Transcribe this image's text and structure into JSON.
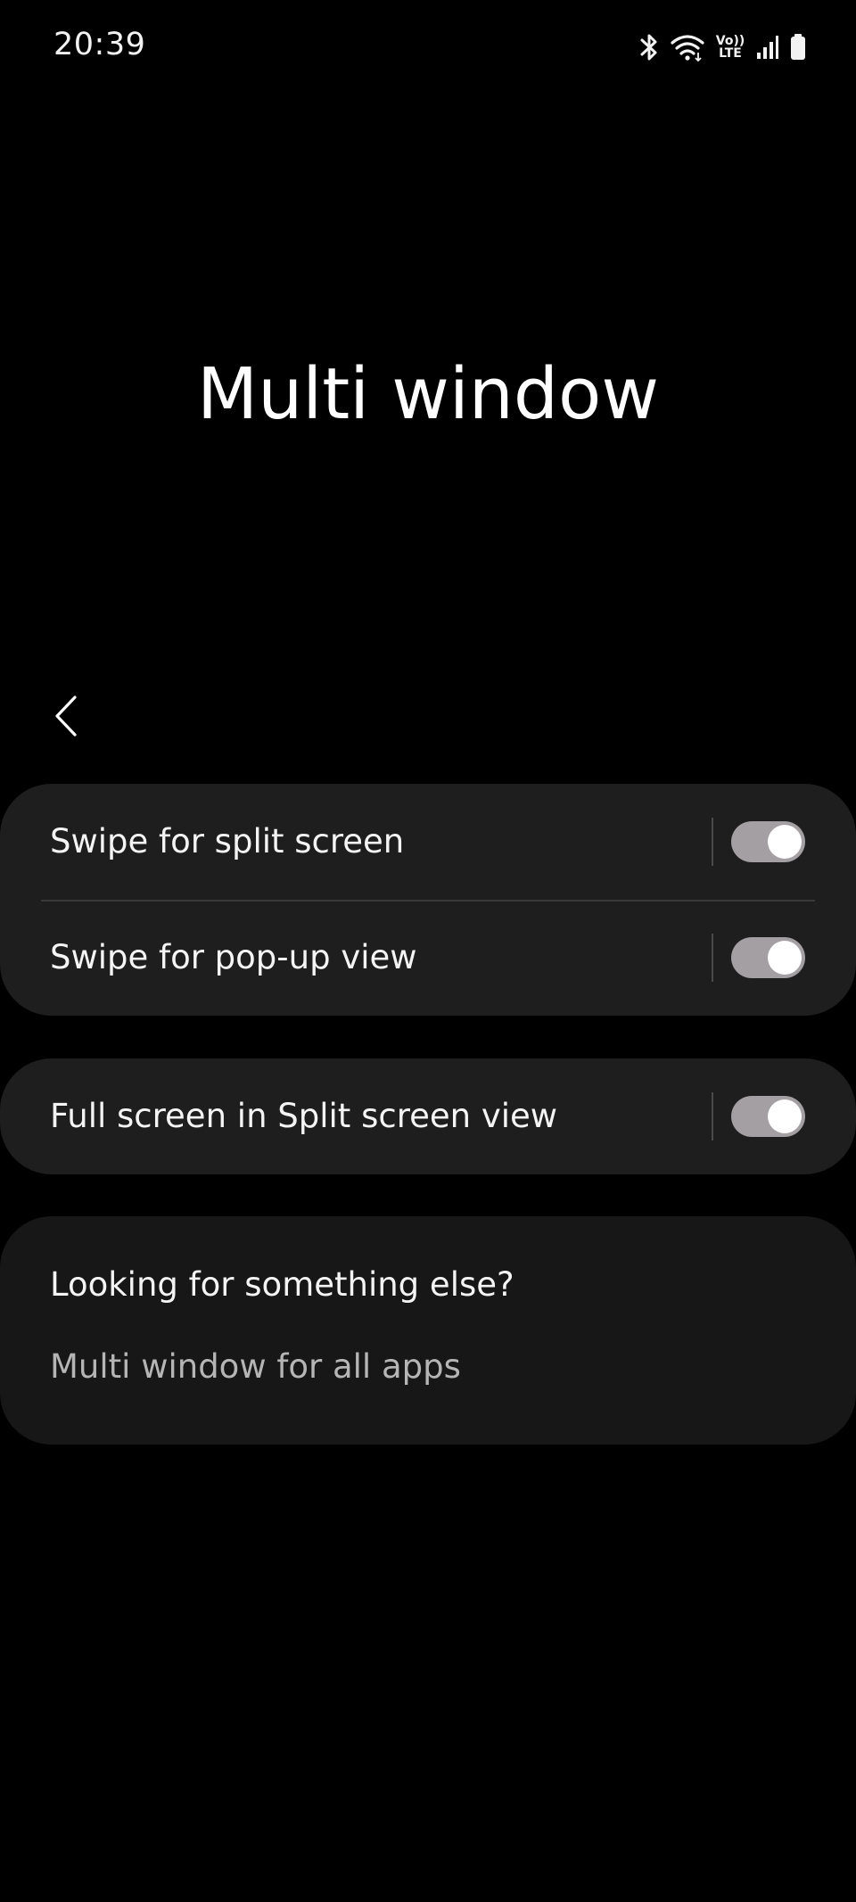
{
  "status_bar": {
    "time": "20:39",
    "icons": [
      "bluetooth-icon",
      "wifi-icon",
      "volte-icon",
      "signal-icon",
      "battery-icon"
    ],
    "volte_top": "Vo))",
    "volte_bottom": "LTE"
  },
  "page": {
    "title": "Multi window",
    "back_icon": "chevron-left-icon"
  },
  "settings": {
    "swipe_split": {
      "label": "Swipe for split screen",
      "enabled": true
    },
    "swipe_popup": {
      "label": "Swipe for pop-up view",
      "enabled": true
    },
    "full_screen_split": {
      "label": "Full screen in Split screen view",
      "enabled": true
    }
  },
  "suggestions": {
    "heading": "Looking for something else?",
    "link": "Multi window for all apps"
  },
  "colors": {
    "background": "#000000",
    "card": "#1e1e1e",
    "toggle_track": "#a49fa2",
    "toggle_knob": "#ffffff"
  }
}
